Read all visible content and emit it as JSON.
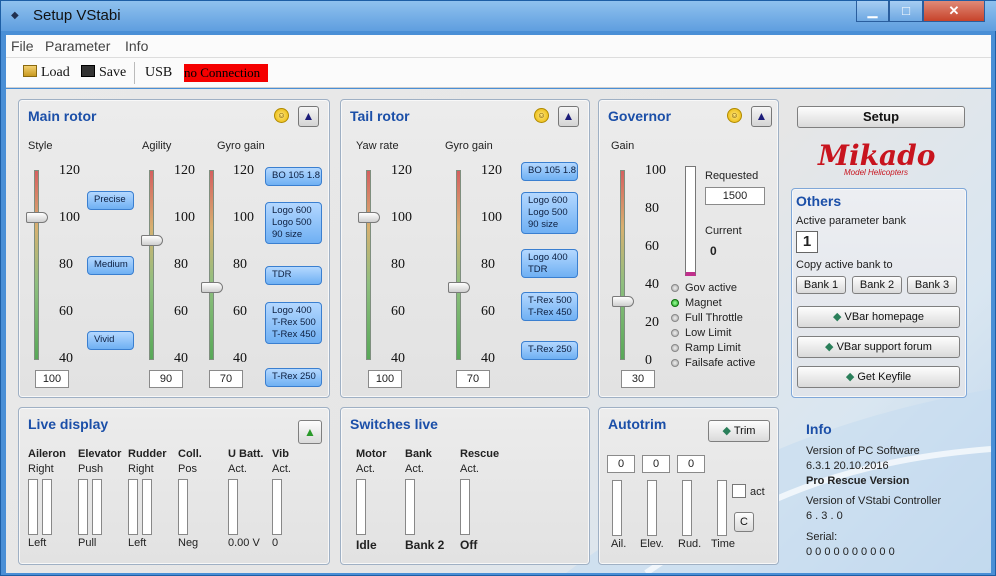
{
  "window": {
    "title": "Setup VStabi",
    "min": "▁",
    "max": "□",
    "close": "✕"
  },
  "menu": [
    "File",
    "Parameter",
    "Info"
  ],
  "toolbar": {
    "load": "Load",
    "save": "Save",
    "usb": "USB",
    "connection": "no Connection"
  },
  "main_rotor": {
    "title": "Main rotor",
    "style": {
      "label": "Style",
      "ticks": [
        "120",
        "100",
        "80",
        "60",
        "40"
      ],
      "value": "100",
      "bubbles": [
        "Precise",
        "Medium",
        "Vivid"
      ]
    },
    "agility": {
      "label": "Agility",
      "ticks": [
        "120",
        "100",
        "80",
        "60",
        "40"
      ],
      "value": "90"
    },
    "gyro": {
      "label": "Gyro gain",
      "ticks": [
        "120",
        "100",
        "80",
        "60",
        "40"
      ],
      "value": "70",
      "bubbles": [
        "BO 105 1.8",
        "Logo 600\nLogo 500\n90 size",
        "TDR",
        "Logo 400\nT-Rex 500\nT-Rex 450",
        "T-Rex 250"
      ]
    }
  },
  "tail_rotor": {
    "title": "Tail rotor",
    "yaw": {
      "label": "Yaw rate",
      "ticks": [
        "120",
        "100",
        "80",
        "60",
        "40"
      ],
      "value": "100"
    },
    "gyro": {
      "label": "Gyro gain",
      "ticks": [
        "120",
        "100",
        "80",
        "60",
        "40"
      ],
      "value": "70",
      "bubbles": [
        "BO 105 1.8",
        "Logo 600\nLogo 500\n90 size",
        "Logo 400\nTDR",
        "T-Rex 500\nT-Rex 450",
        "T-Rex 250"
      ]
    }
  },
  "governor": {
    "title": "Governor",
    "gain": {
      "label": "Gain",
      "ticks": [
        "100",
        "80",
        "60",
        "40",
        "20",
        "0"
      ],
      "value": "30"
    },
    "requested_label": "Requested",
    "requested_value": "1500",
    "current_label": "Current",
    "current_value": "0",
    "status": [
      {
        "label": "Gov active",
        "on": false
      },
      {
        "label": "Magnet",
        "on": true
      },
      {
        "label": "Full Throttle",
        "on": false
      },
      {
        "label": "Low Limit",
        "on": false
      },
      {
        "label": "Ramp Limit",
        "on": false
      },
      {
        "label": "Failsafe active",
        "on": false
      }
    ]
  },
  "setup_button": "Setup",
  "logo": {
    "text": "Mikado",
    "tagline": "Model Helicopters"
  },
  "others": {
    "title": "Others",
    "active_bank_label": "Active parameter bank",
    "active_bank": "1",
    "copy_label": "Copy active bank to",
    "banks": [
      "Bank 1",
      "Bank 2",
      "Bank 3"
    ],
    "links": [
      "VBar homepage",
      "VBar support forum",
      "Get Keyfile"
    ]
  },
  "live_display": {
    "title": "Live display",
    "channels": [
      {
        "name": "Aileron",
        "top": "Right",
        "bottom": "Left"
      },
      {
        "name": "Elevator",
        "top": "Push",
        "bottom": "Pull"
      },
      {
        "name": "Rudder",
        "top": "Right",
        "bottom": "Left"
      },
      {
        "name": "Coll.",
        "top": "Pos",
        "bottom": "Neg"
      },
      {
        "name": "U Batt.",
        "top": "Act.",
        "bottom": "0.00 V"
      },
      {
        "name": "Vib",
        "top": "Act.",
        "bottom": "0"
      }
    ]
  },
  "switches_live": {
    "title": "Switches live",
    "items": [
      {
        "name": "Motor",
        "top": "Act.",
        "state": "Idle"
      },
      {
        "name": "Bank",
        "top": "Act.",
        "state": "Bank 2"
      },
      {
        "name": "Rescue",
        "top": "Act.",
        "state": "Off"
      }
    ]
  },
  "autotrim": {
    "title": "Autotrim",
    "trim_button": "Trim",
    "values": [
      "0",
      "0",
      "0"
    ],
    "labels": [
      "Ail.",
      "Elev.",
      "Rud.",
      "Time"
    ],
    "act_label": "act",
    "c_button": "C"
  },
  "info": {
    "title": "Info",
    "pc_label": "Version of PC Software",
    "pc_version": "6.3.1  20.10.2016",
    "edition": "Pro Rescue Version",
    "ctrl_label": "Version of VStabi Controller",
    "ctrl_version": "6 . 3 . 0",
    "serial_label": "Serial:",
    "serial": "0 0 0 0 0 0 0 0 0 0"
  }
}
